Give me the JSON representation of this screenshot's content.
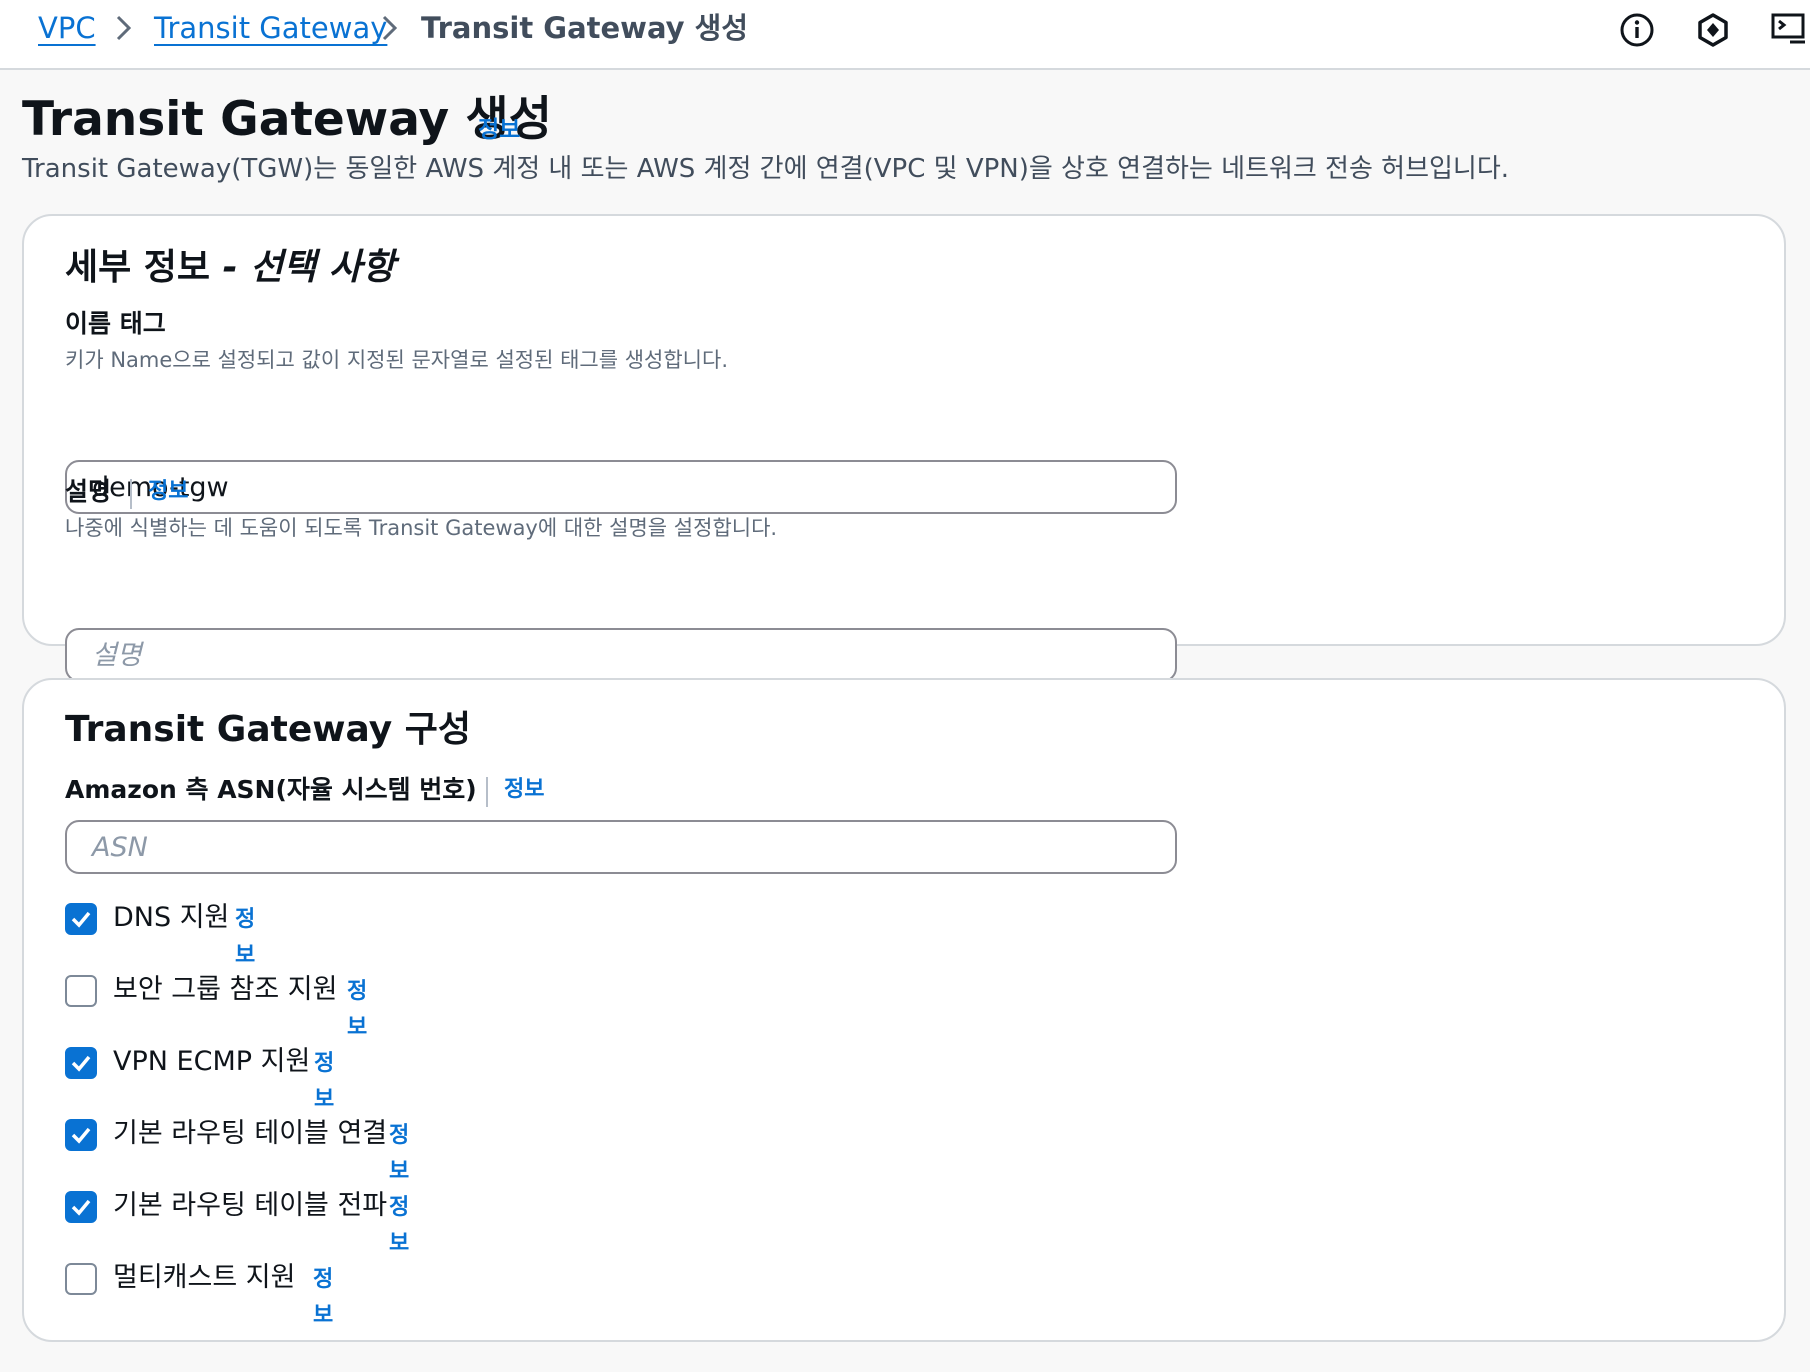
{
  "breadcrumb": {
    "items": [
      "VPC",
      "Transit Gateway"
    ],
    "current": "Transit Gateway 생성"
  },
  "top_icons": [
    "info-circle-icon",
    "settings-hexagon-icon",
    "cloudshell-terminal-icon"
  ],
  "page": {
    "title": "Transit Gateway 생성",
    "info": "정보",
    "description": "Transit Gateway(TGW)는 동일한 AWS 계정 내 또는 AWS 계정 간에 연결(VPC 및 VPN)을 상호 연결하는 네트워크 전송 허브입니다."
  },
  "details": {
    "title": "세부 정보",
    "title_suffix": "- 선택 사항",
    "name_tag": {
      "label": "이름 태그",
      "description": "키가 Name으로 설정되고 값이 지정된 문자열로 설정된 태그를 생성합니다.",
      "value": "demo-tgw"
    },
    "description_field": {
      "label": "설명",
      "info": "정보",
      "description": "나중에 식별하는 데 도움이 되도록 Transit Gateway에 대한 설명을 설정합니다.",
      "placeholder": "설명"
    }
  },
  "config": {
    "title": "Transit Gateway 구성",
    "asn": {
      "label": "Amazon 측 ASN(자율 시스템 번호)",
      "info": "정보",
      "placeholder": "ASN"
    },
    "options": [
      {
        "label": "DNS 지원",
        "info": "정보",
        "checked": true
      },
      {
        "label": "보안 그룹 참조 지원",
        "info": "정보",
        "checked": false
      },
      {
        "label": "VPN ECMP 지원",
        "info": "정보",
        "checked": true
      },
      {
        "label": "기본 라우팅 테이블 연결",
        "info": "정보",
        "checked": true
      },
      {
        "label": "기본 라우팅 테이블 전파",
        "info": "정보",
        "checked": true
      },
      {
        "label": "멀티캐스트 지원",
        "info": "정보",
        "checked": false
      }
    ]
  },
  "colors": {
    "link": "#0972d3",
    "checkbox_checked": "#0972d3",
    "border": "#d5d9dd"
  }
}
